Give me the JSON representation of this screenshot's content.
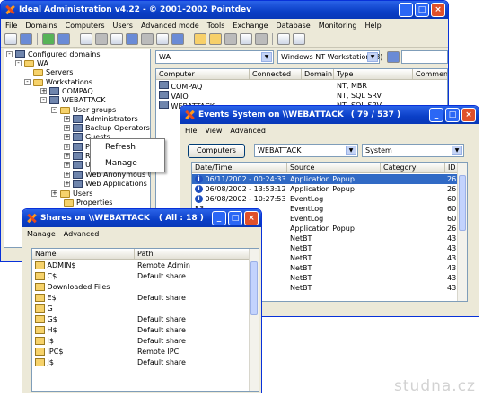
{
  "main": {
    "title": "Ideal Administration v4.22 - © 2001-2002 Pointdev",
    "menu": [
      "File",
      "Domains",
      "Computers",
      "Users",
      "Advanced mode",
      "Tools",
      "Exchange",
      "Database",
      "Monitoring",
      "Help"
    ],
    "domain_combo": "WA",
    "os_combo": "Windows NT Workstation (3)",
    "tree": [
      {
        "label": "Configured domains",
        "icon": "network-icon"
      },
      {
        "label": "WA",
        "icon": "folder-icon"
      },
      {
        "label": "Servers",
        "icon": "folder-icon"
      },
      {
        "label": "Workstations",
        "icon": "folder-icon"
      },
      {
        "label": "COMPAQ",
        "icon": "computer-icon"
      },
      {
        "label": "WEBATTACK",
        "icon": "computer-icon"
      },
      {
        "label": "User groups",
        "icon": "folder-icon"
      },
      {
        "label": "Administrators",
        "icon": "group-icon"
      },
      {
        "label": "Backup Operators",
        "icon": "group-icon"
      },
      {
        "label": "Guests",
        "icon": "group-icon"
      },
      {
        "label": "Po",
        "icon": "group-icon"
      },
      {
        "label": "Re",
        "icon": "group-icon"
      },
      {
        "label": "Us",
        "icon": "group-icon"
      },
      {
        "label": "Web Anonymous U",
        "icon": "group-icon"
      },
      {
        "label": "Web Applications",
        "icon": "group-icon"
      },
      {
        "label": "Users",
        "icon": "folder-icon"
      },
      {
        "label": "Properties",
        "icon": "properties-icon"
      }
    ],
    "columns": [
      "Computer",
      "Connected",
      "Domain",
      "Type",
      "Comment"
    ],
    "rows": [
      {
        "computer": "COMPAQ",
        "connected": "",
        "domain": "",
        "type": "NT, MBR"
      },
      {
        "computer": "VAIO",
        "connected": "",
        "domain": "",
        "type": "NT, SQL SRV"
      },
      {
        "computer": "WEBATTACK",
        "connected": "",
        "domain": "",
        "type": "NT, SQL SRV"
      }
    ]
  },
  "context_menu": {
    "items": [
      "Refresh",
      "Manage"
    ]
  },
  "events": {
    "title": "Events System on \\\\WEBATTACK",
    "count": "( 79 / 537 )",
    "menu": [
      "File",
      "View",
      "Advanced"
    ],
    "computers_button": "Computers",
    "computer_combo": "WEBATTACK",
    "log_combo": "System",
    "columns": [
      "Date/Time",
      "Source",
      "Category",
      "ID"
    ],
    "rows": [
      {
        "time": "06/11/2002 - 00:24:33",
        "source": "Application Popup",
        "id": "26",
        "icon": "info-icon"
      },
      {
        "time": "06/08/2002 - 13:53:12",
        "source": "Application Popup",
        "id": "26",
        "icon": "info-icon"
      },
      {
        "time": "06/08/2002 - 10:27:53",
        "source": "EventLog",
        "id": "60",
        "icon": "info-icon"
      },
      {
        "time": "53",
        "source": "EventLog",
        "id": "60",
        "icon": ""
      },
      {
        "time": "53",
        "source": "EventLog",
        "id": "60",
        "icon": ""
      },
      {
        "time": "26",
        "source": "Application Popup",
        "id": "26",
        "icon": ""
      },
      {
        "time": "51",
        "source": "NetBT",
        "id": "43",
        "icon": ""
      },
      {
        "time": "51",
        "source": "NetBT",
        "id": "43",
        "icon": ""
      },
      {
        "time": "51",
        "source": "NetBT",
        "id": "43",
        "icon": ""
      },
      {
        "time": "51",
        "source": "NetBT",
        "id": "43",
        "icon": ""
      },
      {
        "time": "51",
        "source": "NetBT",
        "id": "43",
        "icon": ""
      },
      {
        "time": "51",
        "source": "NetBT",
        "id": "43",
        "icon": ""
      }
    ]
  },
  "shares": {
    "title": "Shares on \\\\WEBATTACK",
    "count": "( All : 18 )",
    "menu": [
      "Manage",
      "Advanced"
    ],
    "columns": [
      "Name",
      "Path"
    ],
    "rows": [
      {
        "name": "ADMIN$",
        "path": "Remote Admin"
      },
      {
        "name": "C$",
        "path": "Default share"
      },
      {
        "name": "Downloaded Files",
        "path": ""
      },
      {
        "name": "E$",
        "path": "Default share"
      },
      {
        "name": "G",
        "path": ""
      },
      {
        "name": "G$",
        "path": "Default share"
      },
      {
        "name": "H$",
        "path": "Default share"
      },
      {
        "name": "I$",
        "path": "Default share"
      },
      {
        "name": "IPC$",
        "path": "Remote IPC"
      },
      {
        "name": "J$",
        "path": "Default share"
      }
    ]
  },
  "watermark": "studna.cz"
}
